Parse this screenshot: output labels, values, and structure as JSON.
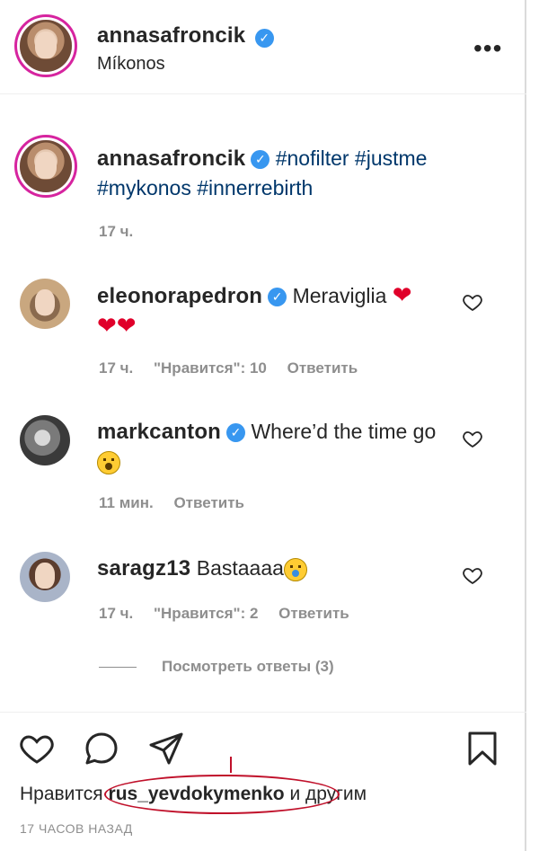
{
  "header": {
    "username": "annasafroncik",
    "verified": true,
    "location": "Míkonos",
    "more_label": "•••"
  },
  "caption": {
    "username": "annasafroncik",
    "hashtags": "#nofilter #justme #mykonos #innerrebirth",
    "time": "17 ч."
  },
  "comments": [
    {
      "username": "eleonorapedron",
      "verified": true,
      "text": "Meraviglia",
      "time": "17 ч.",
      "likes": "\"Нравится\": 10",
      "reply": "Ответить"
    },
    {
      "username": "markcanton",
      "verified": true,
      "text": "Where’d the time go",
      "time": "11 мин.",
      "reply": "Ответить"
    },
    {
      "username": "saragz13",
      "verified": false,
      "text": "Bastaaaa",
      "time": "17 ч.",
      "likes": "\"Нравится\": 2",
      "reply": "Ответить"
    }
  ],
  "view_replies": "Посмотреть ответы (3)",
  "likes_line": {
    "prefix": "Нравится",
    "user": "rus_yevdokymenko",
    "suffix": "и другим"
  },
  "time_ago": "17 ЧАСОВ НАЗАД",
  "colors": {
    "hashtag": "#00376b",
    "verified": "#3897f0",
    "meta": "#8e8e8e",
    "annotation": "#c0102a"
  },
  "icons": [
    "more-icon",
    "verified-icon",
    "heart-icon",
    "comment-icon",
    "share-icon",
    "bookmark-icon"
  ]
}
